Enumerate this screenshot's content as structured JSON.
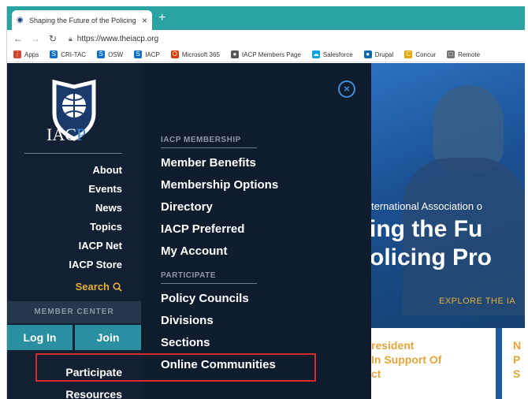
{
  "browser": {
    "tab_title": "Shaping the Future of the Policing",
    "url": "https://www.theiacp.org",
    "bookmarks": [
      {
        "label": "Apps",
        "icon": "apps-grid-icon",
        "color": "#d2452f"
      },
      {
        "label": "CRI-TAC",
        "icon": "sharepoint-icon",
        "color": "#0f6fc6"
      },
      {
        "label": "OSW",
        "icon": "sharepoint-icon",
        "color": "#0f6fc6"
      },
      {
        "label": "IACP",
        "icon": "sharepoint-icon",
        "color": "#0f6fc6"
      },
      {
        "label": "Microsoft 365",
        "icon": "office-icon",
        "color": "#d83b01"
      },
      {
        "label": "IACP Members Page",
        "icon": "person-icon",
        "color": "#555555"
      },
      {
        "label": "Salesforce",
        "icon": "cloud-icon",
        "color": "#00a1e0"
      },
      {
        "label": "Drupal",
        "icon": "drupal-icon",
        "color": "#0b6aa8"
      },
      {
        "label": "Concur",
        "icon": "concur-icon",
        "color": "#e6a800"
      },
      {
        "label": "Remote",
        "icon": "page-icon",
        "color": "#777777"
      }
    ]
  },
  "brand": {
    "logo_text_main": "IAC",
    "logo_text_accent": "P"
  },
  "nav": {
    "items": [
      "About",
      "Events",
      "News",
      "Topics",
      "IACP Net",
      "IACP Store"
    ],
    "search_label": "Search"
  },
  "member": {
    "center_label": "MEMBER CENTER",
    "login_label": "Log In",
    "join_label": "Join",
    "participate_label": "Participate",
    "resources_label": "Resources"
  },
  "dropdown": {
    "membership_heading": "IACP MEMBERSHIP",
    "membership_links": [
      "Member Benefits",
      "Membership Options",
      "Directory",
      "IACP Preferred",
      "My Account"
    ],
    "participate_heading": "PARTICIPATE",
    "participate_links": [
      "Policy Councils",
      "Divisions",
      "Sections",
      "Online Communities"
    ]
  },
  "hero": {
    "small_text": "ternational Association o",
    "big_line_1": "ing the Fu",
    "big_line_2": "olicing Pro",
    "explore_text": "EXPLORE THE IA",
    "card1_lines": [
      "resident",
      "In Support Of",
      "ct"
    ],
    "card2_lines": [
      "N",
      "P",
      "S"
    ]
  },
  "colors": {
    "tabstrip": "#2aa3a3",
    "nav_bg": "#132033",
    "accent_gold": "#e4b03a",
    "button_teal": "#2a8fa1",
    "highlight_red": "#d42b2b"
  }
}
